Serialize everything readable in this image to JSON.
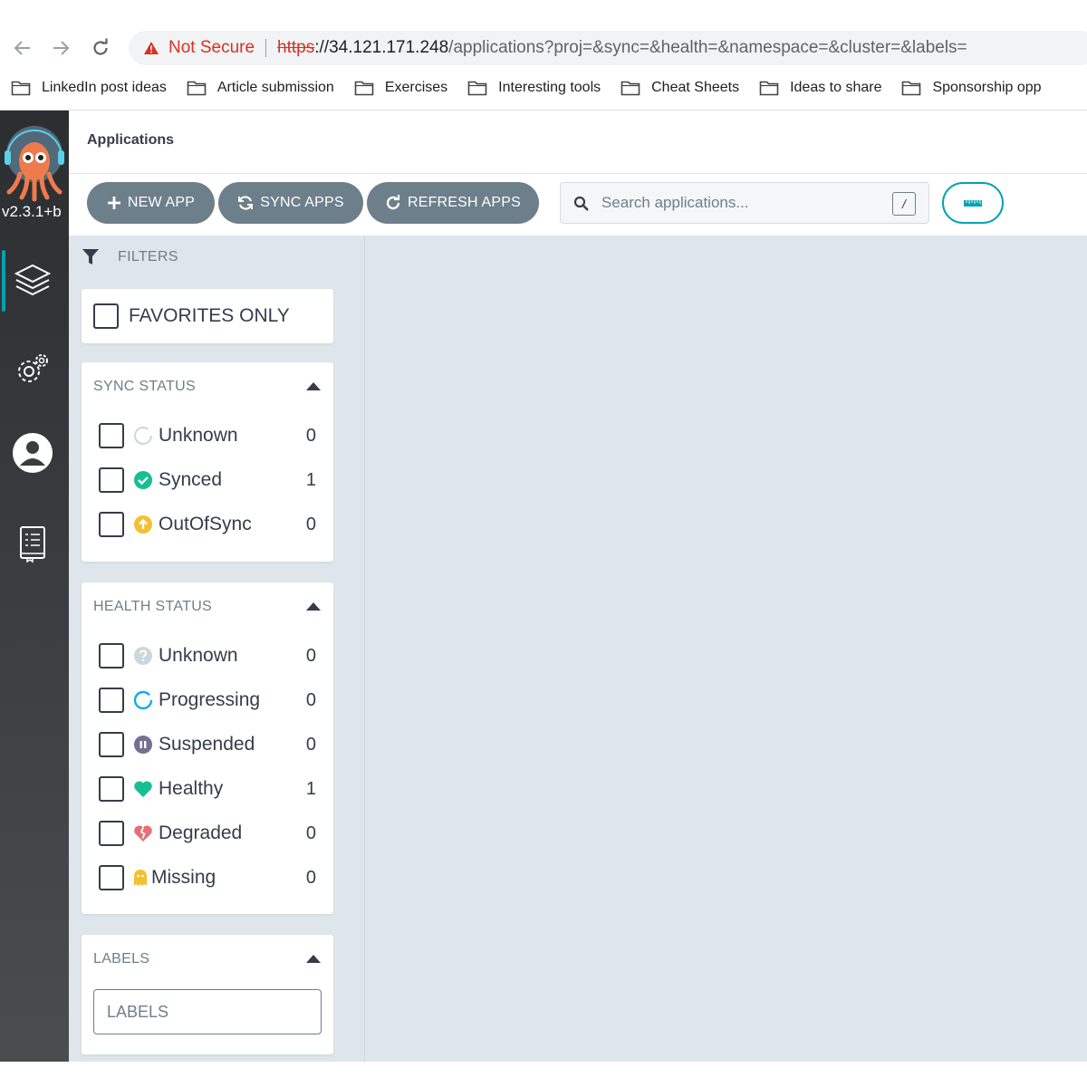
{
  "browser": {
    "security_label": "Not Secure",
    "url_protocol": "https",
    "url_host": "://34.121.171.248",
    "url_path": "/applications?proj=&sync=&health=&namespace=&cluster=&labels=",
    "bookmarks": [
      {
        "label": "LinkedIn post ideas"
      },
      {
        "label": "Article submission"
      },
      {
        "label": "Exercises"
      },
      {
        "label": "Interesting tools"
      },
      {
        "label": "Cheat Sheets"
      },
      {
        "label": "Ideas to share"
      },
      {
        "label": "Sponsorship opp"
      }
    ]
  },
  "sidebar": {
    "version": "v2.3.1+b",
    "items": [
      {
        "icon": "layers-icon",
        "active": true
      },
      {
        "icon": "settings-gears-icon"
      },
      {
        "icon": "user-icon"
      },
      {
        "icon": "docs-icon"
      }
    ]
  },
  "header": {
    "title": "Applications"
  },
  "toolbar": {
    "new_app_label": "NEW APP",
    "sync_apps_label": "SYNC APPS",
    "refresh_apps_label": "REFRESH APPS",
    "search_placeholder": "Search applications...",
    "search_shortcut": "/",
    "view_toggle_icon": "ruler-icon"
  },
  "filters": {
    "title": "FILTERS",
    "favorites_label": "FAVORITES ONLY",
    "sync_status": {
      "title": "SYNC STATUS",
      "items": [
        {
          "label": "Unknown",
          "count": "0",
          "icon": "circle-notch-icon"
        },
        {
          "label": "Synced",
          "count": "1",
          "icon": "check-circle-icon"
        },
        {
          "label": "OutOfSync",
          "count": "0",
          "icon": "arrow-up-circle-icon"
        }
      ]
    },
    "health_status": {
      "title": "HEALTH STATUS",
      "items": [
        {
          "label": "Unknown",
          "count": "0",
          "icon": "question-circle-icon"
        },
        {
          "label": "Progressing",
          "count": "0",
          "icon": "progress-circle-icon"
        },
        {
          "label": "Suspended",
          "count": "0",
          "icon": "pause-circle-icon"
        },
        {
          "label": "Healthy",
          "count": "1",
          "icon": "heart-icon"
        },
        {
          "label": "Degraded",
          "count": "0",
          "icon": "broken-heart-icon"
        },
        {
          "label": "Missing",
          "count": "0",
          "icon": "ghost-icon"
        }
      ]
    },
    "labels": {
      "title": "LABELS",
      "placeholder": "LABELS"
    }
  },
  "colors": {
    "accent": "#00a2b3",
    "button": "#6d7f8b",
    "synced": "#18be94",
    "out_of_sync": "#f4c030",
    "healthy": "#18be94",
    "degraded": "#e96d76",
    "suspended": "#766f94",
    "missing": "#f4c030",
    "not_secure": "#d93025"
  }
}
